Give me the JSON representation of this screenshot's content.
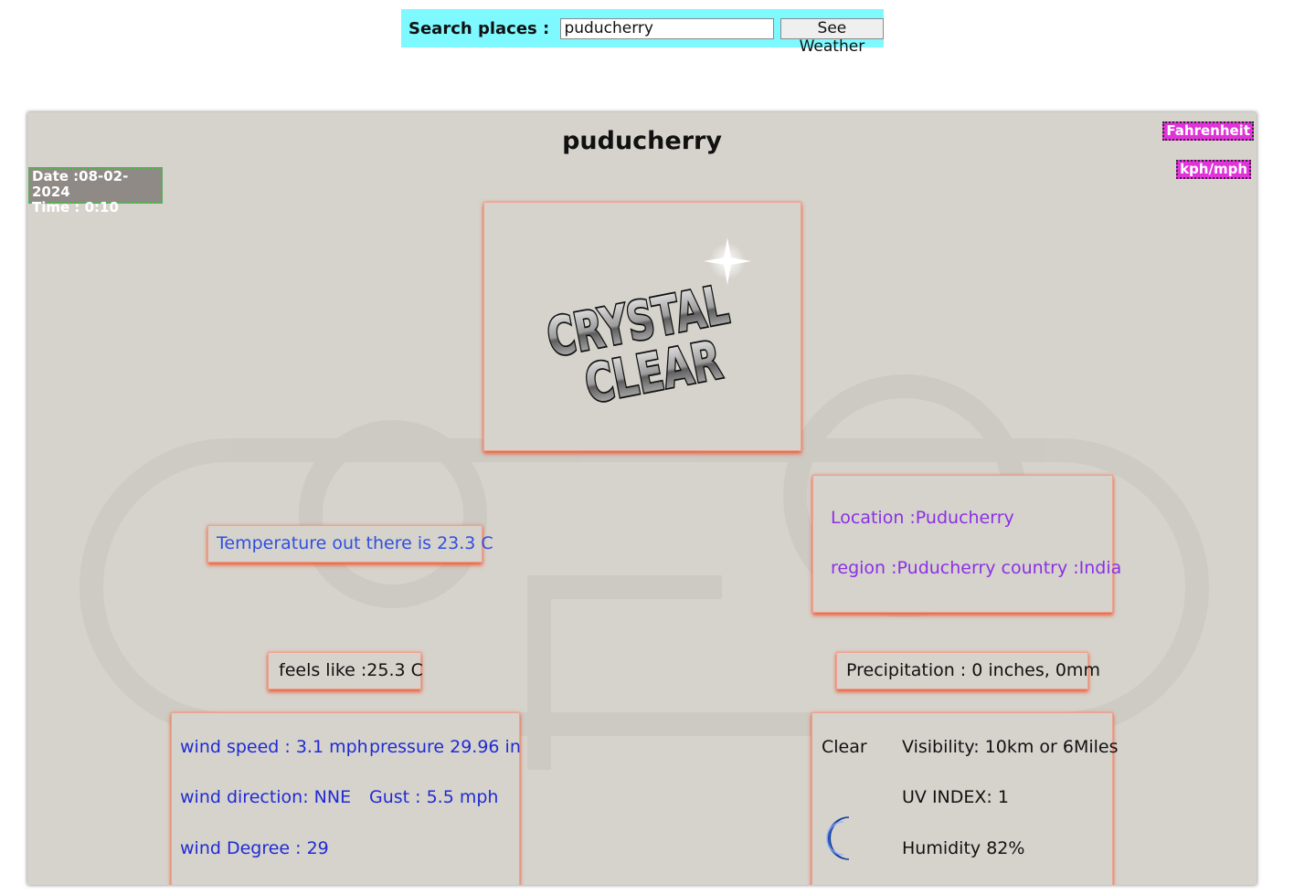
{
  "search": {
    "label": "Search places : ",
    "value": "puducherry",
    "button_label": "See Weather"
  },
  "weather": {
    "city_title": "puducherry",
    "date_line": "Date :08-02-2024",
    "time_line": "Time : 0:10",
    "unit_buttons": {
      "fahrenheit": "Fahrenheit",
      "speed": "kph/mph"
    },
    "condition_image_text": [
      "CRYSTAL",
      "CLEAR"
    ],
    "temperature": "Temperature out there is 23.3 C",
    "feels_like": "feels like :25.3 C",
    "location": "Location :Puducherry",
    "region": "region :Puducherry country :India",
    "precipitation": "Precipitation : 0 inches, 0mm",
    "wind_speed": "wind speed : 3.1 mph",
    "pressure": "pressure 29.96 in",
    "wind_direction": "wind direction: NNE",
    "gust": "Gust : 5.5 mph",
    "wind_degree": "wind Degree : 29",
    "condition": "Clear",
    "visibility": "Visibility: 10km or 6Miles",
    "uv_index": "UV INDEX: 1",
    "humidity": "Humidity 82%",
    "condition_icon": "moon-icon"
  },
  "colors": {
    "search_bar_bg": "#7ef9ff",
    "panel_bg": "#d6d3cc",
    "card_shadow": "#f05a32",
    "unit_button_bg": "#e034d8",
    "date_bg": "#8f8a86",
    "temperature_text": "#2f4fe0",
    "location_text": "#8c2fe6",
    "wind_text": "#1f2bd4",
    "moon_icon": "#2f6fe0"
  }
}
